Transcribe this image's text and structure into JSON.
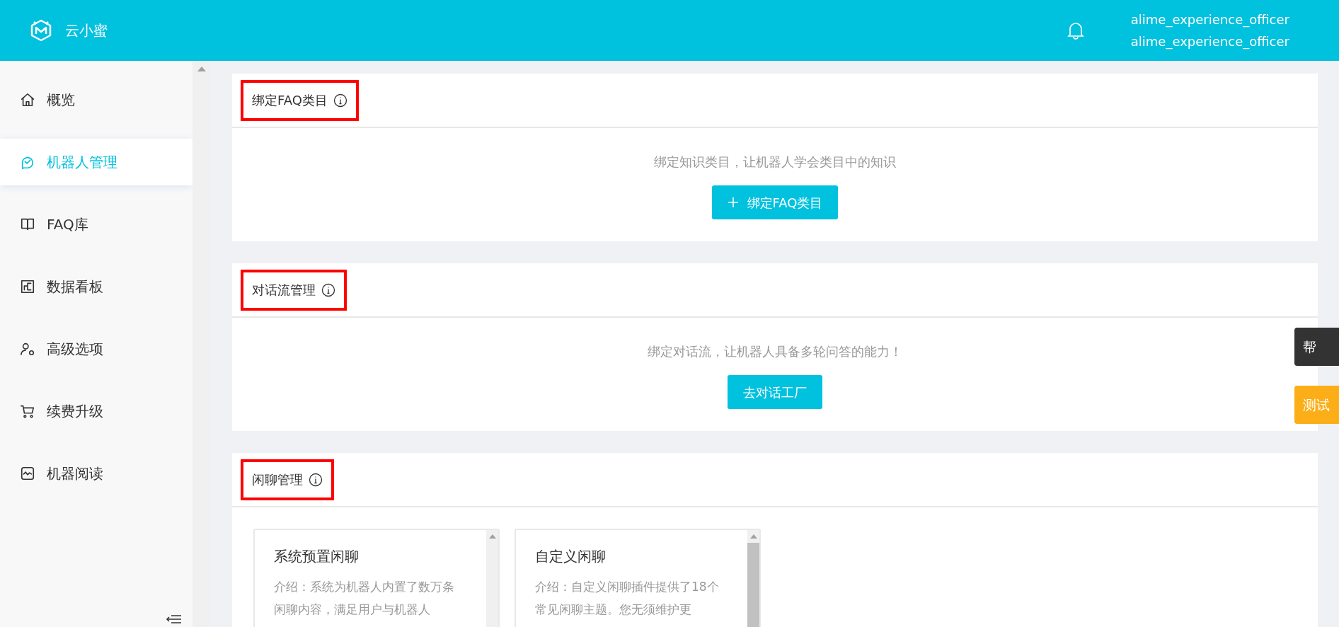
{
  "header": {
    "app_name": "云小蜜",
    "user_lines": [
      "alime_experience_officer",
      "alime_experience_officer"
    ]
  },
  "sidebar": {
    "items": [
      {
        "label": "概览",
        "selected": false
      },
      {
        "label": "机器人管理",
        "selected": true
      },
      {
        "label": "FAQ库",
        "selected": false
      },
      {
        "label": "数据看板",
        "selected": false
      },
      {
        "label": "高级选项",
        "selected": false
      },
      {
        "label": "续费升级",
        "selected": false
      },
      {
        "label": "机器阅读",
        "selected": false
      }
    ]
  },
  "sections": [
    {
      "title": "绑定FAQ类目",
      "highlighted": true,
      "kind": "empty",
      "message": "绑定知识类目，让机器人学会类目中的知识",
      "button": {
        "label": "绑定FAQ类目",
        "kind": "add"
      }
    },
    {
      "title": "对话流管理",
      "highlighted": true,
      "kind": "empty",
      "message": "绑定对话流，让机器人具备多轮问答的能力！",
      "button": {
        "label": "去对话工厂",
        "kind": "link"
      }
    },
    {
      "title": "闲聊管理",
      "highlighted": true,
      "kind": "cards",
      "cards": [
        {
          "title": "系统预置闲聊",
          "description": "介绍：系统为机器人内置了数万条闲聊内容，满足用户与机器人"
        },
        {
          "title": "自定义闲聊",
          "description": "介绍：自定义闲聊插件提供了18个常见闲聊主题。您无须维护更"
        }
      ]
    }
  ],
  "floating_tabs": [
    {
      "label": "帮",
      "color": "#333333"
    },
    {
      "label": "测试",
      "color": "#fbae17"
    }
  ]
}
